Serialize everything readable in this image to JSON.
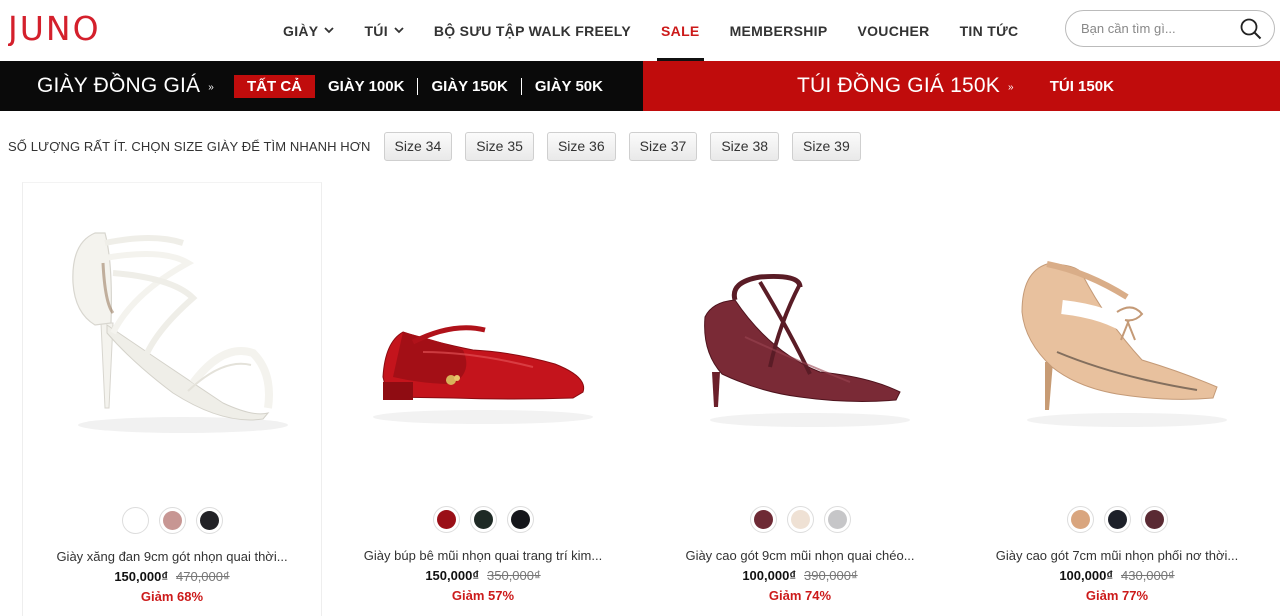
{
  "brand": {
    "logo_text": "JUNO",
    "color": "#d4202c"
  },
  "nav": {
    "items": [
      {
        "label": "GIÀY",
        "has_dropdown": true
      },
      {
        "label": "TÚI",
        "has_dropdown": true
      },
      {
        "label": "BỘ SƯU TẬP WALK FREELY"
      },
      {
        "label": "SALE",
        "active": true
      },
      {
        "label": "MEMBERSHIP"
      },
      {
        "label": "VOUCHER"
      },
      {
        "label": "TIN TỨC"
      }
    ],
    "chevron": "⌄"
  },
  "search": {
    "placeholder": "Bạn cần tìm gì...",
    "icon": "search-icon"
  },
  "promo": {
    "left": {
      "title": "GIÀY ĐỒNG GIÁ",
      "arrow": "»",
      "active_chip": "TẤT CẢ",
      "links": [
        "GIÀY 100K",
        "GIÀY 150K",
        "GIÀY 50K"
      ]
    },
    "right": {
      "title": "TÚI ĐỒNG GIÁ 150K",
      "arrow": "»",
      "link": "TÚI 150K"
    }
  },
  "size_filter": {
    "label": "SỐ LƯỢNG RẤT ÍT. CHỌN SIZE GIÀY ĐỂ TÌM NHANH HƠN",
    "sizes": [
      "Size 34",
      "Size 35",
      "Size 36",
      "Size 37",
      "Size 38",
      "Size 39"
    ]
  },
  "products": [
    {
      "name": "Giày xăng đan 9cm gót nhọn quai thời...",
      "price": "150,000₫",
      "old_price": "470,000₫",
      "discount": "Giảm 68%",
      "swatches": [
        "#ffffff",
        "#c79693",
        "#222226"
      ],
      "shoe_color": "#f4f3ee"
    },
    {
      "name": "Giày búp bê mũi nhọn quai trang trí kim...",
      "price": "150,000₫",
      "old_price": "350,000₫",
      "discount": "Giảm 57%",
      "swatches": [
        "#9a0f17",
        "#1e2a25",
        "#15161b"
      ],
      "shoe_color": "#c4141c"
    },
    {
      "name": "Giày cao gót 9cm mũi nhọn quai chéo...",
      "price": "100,000₫",
      "old_price": "390,000₫",
      "discount": "Giảm 74%",
      "swatches": [
        "#6e2a35",
        "#efe1d4",
        "#c6c6c8"
      ],
      "shoe_color": "#7a2a36"
    },
    {
      "name": "Giày cao gót 7cm mũi nhọn phối nơ thời...",
      "price": "100,000₫",
      "old_price": "430,000₫",
      "discount": "Giảm 77%",
      "swatches": [
        "#d9a57e",
        "#1d2029",
        "#5a2a33"
      ],
      "shoe_color": "#e8c19e"
    }
  ]
}
